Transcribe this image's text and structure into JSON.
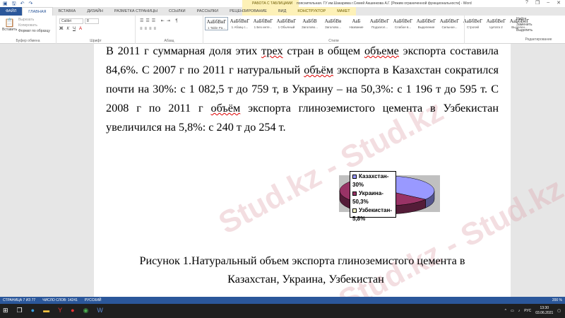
{
  "titlebar": {
    "document_title": "пояснительная. ГУ им.Шакарима г.Семей Акшинкова А.Г. [Режим ограниченной функциональности] - Word",
    "context_group": "РАБОТА С ТАБЛИЦАМИ",
    "help": "?",
    "minimize": "–",
    "restore": "❐",
    "close": "✕"
  },
  "tabs": [
    "ФАЙЛ",
    "ГЛАВНАЯ",
    "ВСТАВКА",
    "ДИЗАЙН",
    "РАЗМЕТКА СТРАНИЦЫ",
    "ССЫЛКИ",
    "РАССЫЛКИ",
    "РЕЦЕНЗИРОВАНИЕ",
    "ВИД",
    "КОНСТРУКТОР",
    "МАКЕТ"
  ],
  "ribbon": {
    "clipboard": {
      "paste": "Вставить",
      "cut": "Вырезать",
      "copy": "Копировать",
      "format_painter": "Формат по образцу",
      "label": "Буфер обмена"
    },
    "font": {
      "name": "Calibri",
      "size": "8",
      "label": "Шрифт"
    },
    "paragraph": {
      "label": "Абзац"
    },
    "styles": {
      "label": "Стили",
      "items": [
        {
          "preview": "АаБбВвГ",
          "name": "1 Table Pa..."
        },
        {
          "preview": "АаБбВвГ",
          "name": "1 Абзац с..."
        },
        {
          "preview": "АаБбВвГ",
          "name": "1 Без инте..."
        },
        {
          "preview": "АаБбВвГ",
          "name": "1 Обычный"
        },
        {
          "preview": "АаБбВ",
          "name": "Заголово..."
        },
        {
          "preview": "АаБбВв",
          "name": "Заголово..."
        },
        {
          "preview": "АаБ",
          "name": "Название"
        },
        {
          "preview": "АаБбВеГ",
          "name": "Подзагол..."
        },
        {
          "preview": "АаБбВеГ",
          "name": "Слабое в..."
        },
        {
          "preview": "АаБбВеГ",
          "name": "Выделение"
        },
        {
          "preview": "АаБбВеГ",
          "name": "Сильное..."
        },
        {
          "preview": "АаБбВеГ",
          "name": "Строгий"
        },
        {
          "preview": "АаБбВеГ",
          "name": "Цитата 2"
        },
        {
          "preview": "АаБбВеГ",
          "name": "Выделен..."
        }
      ]
    },
    "editing": {
      "find": "Найти",
      "replace": "Заменить",
      "select": "Выделить",
      "label": "Редактирование"
    }
  },
  "document": {
    "lines": [
      [
        "В 2011 г суммарная доля этих ",
        "трех",
        " стран в общем ",
        "объеме",
        " экспорта составила"
      ],
      [
        "84,6%. С 2007 г по 2011 г натуральный ",
        "объём",
        " экспорта в Казахстан сократился"
      ],
      [
        "почти на 30%: с 1 082,5 т до 759 т, в Украину – на 50,3%: с 1 196 т до 595 т. С"
      ],
      [
        "2008 г по 2011 г ",
        "объём",
        " экспорта глиноземистого цемента в Узбекистан"
      ],
      [
        "увеличился на 5,8%: с 240 т до 254 т."
      ]
    ],
    "caption_line1": "Рисунок 1.Натуральный объем экспорта глиноземистого цемента в",
    "caption_line2": "Казахстан, Украина, Узбекистан",
    "watermark": "Stud.kz - Stud.kz"
  },
  "chart_data": {
    "type": "pie",
    "title": "",
    "slices": [
      {
        "label_line1": "Казахстан-",
        "label_line2": "30%",
        "value": 30,
        "color": "#9999ff"
      },
      {
        "label_line1": "Украина-",
        "label_line2": "50,3%",
        "value": 50.3,
        "color": "#993366"
      },
      {
        "label_line1": "Узбекистан-",
        "label_line2": "5,8%",
        "value": 5.8,
        "color": "#ffffcc"
      }
    ],
    "legend_position": "right"
  },
  "status": {
    "page": "СТРАНИЦА 7 ИЗ 77",
    "words": "ЧИСЛО СЛОВ: 14241",
    "language": "РУССКИЙ",
    "zoom": "200 %"
  },
  "taskbar": {
    "language": "РУС",
    "time": "13:30",
    "date": "03.06.2021"
  }
}
